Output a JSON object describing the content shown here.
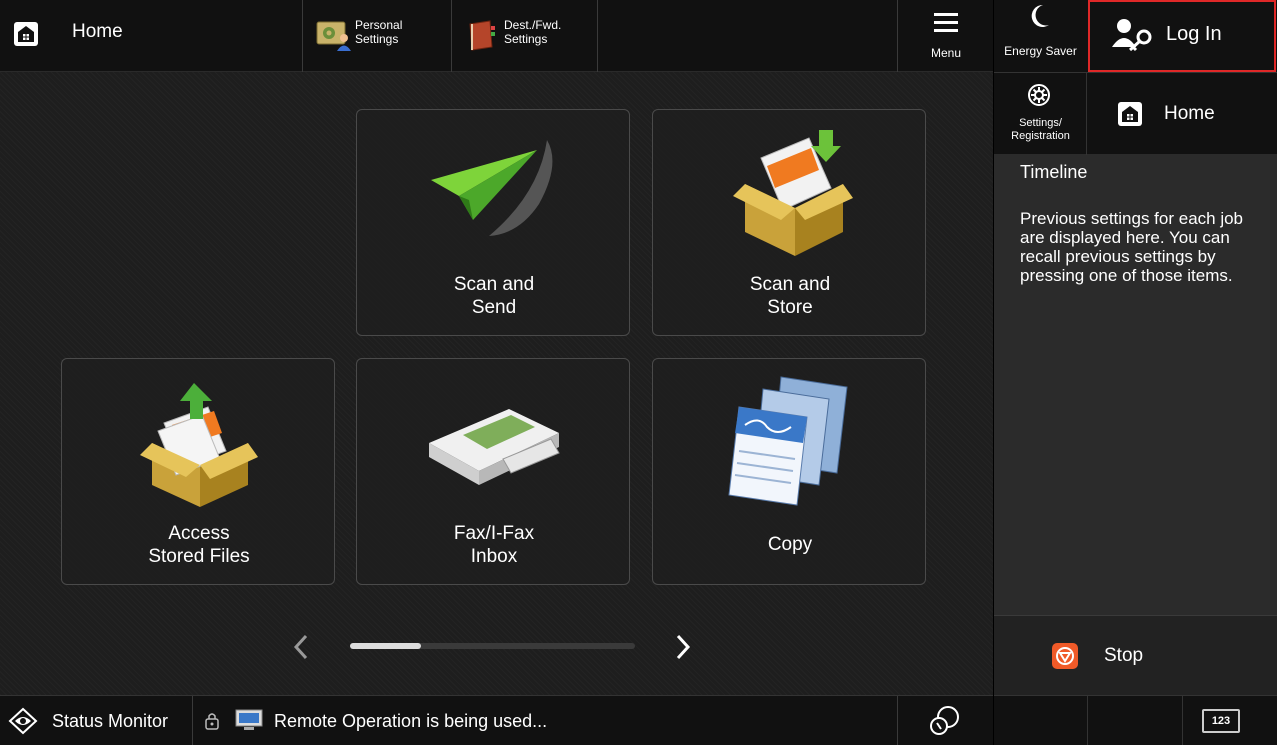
{
  "topbar": {
    "home_label": "Home",
    "personal_settings_label_line1": "Personal",
    "personal_settings_label_line2": "Settings",
    "dest_fwd_label_line1": "Dest./Fwd.",
    "dest_fwd_label_line2": "Settings",
    "menu_label": "Menu"
  },
  "right_panel": {
    "energy_saver_label": "Energy Saver",
    "login_label": "Log In",
    "settings_label_line1": "Settings/",
    "settings_label_line2": "Registration",
    "home_label": "Home",
    "timeline_title": "Timeline",
    "timeline_text": "Previous settings for each job are displayed here. You can recall previous settings by pressing one of those items.",
    "stop_label": "Stop",
    "keyboard_label": "123",
    "login_highlight_color": "#e02828",
    "stop_color": "#f05a28"
  },
  "tiles": {
    "scan_send_line1": "Scan and",
    "scan_send_line2": "Send",
    "scan_store_line1": "Scan and",
    "scan_store_line2": "Store",
    "access_files_line1": "Access",
    "access_files_line2": "Stored Files",
    "fax_inbox_line1": "Fax/I-Fax",
    "fax_inbox_line2": "Inbox",
    "copy_label": "Copy"
  },
  "pager": {
    "position_fraction": 0.25
  },
  "bottombar": {
    "status_monitor_label": "Status Monitor",
    "remote_message": "Remote Operation is being used..."
  },
  "icons": {
    "home": "home-icon",
    "personal_settings": "personal-settings-icon",
    "dest_fwd": "address-book-icon",
    "menu": "hamburger-icon",
    "energy": "moon-icon",
    "login": "user-key-icon",
    "settings": "gear-icon",
    "stop": "stop-icon",
    "status_monitor": "eye-icon",
    "lock": "lock-icon",
    "remote": "monitor-icon",
    "speech": "speech-icon",
    "keyboard": "keyboard-icon"
  }
}
